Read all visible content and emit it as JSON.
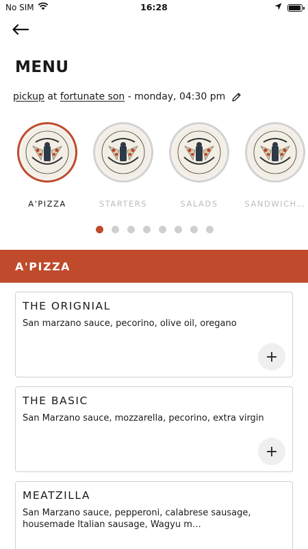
{
  "status_bar": {
    "carrier": "No SIM",
    "time": "16:28",
    "battery_level": 0.95
  },
  "header": {
    "back_icon": "arrow-left-icon",
    "title": "MENU"
  },
  "order_info": {
    "mode": "pickup",
    "at": "at",
    "location": "fortunate son",
    "separator": "-",
    "datetime": "monday, 04:30 pm",
    "edit_icon": "pencil-icon"
  },
  "categories": [
    {
      "label": "A'PIZZA",
      "active": true
    },
    {
      "label": "STARTERS",
      "active": false
    },
    {
      "label": "SALADS",
      "active": false
    },
    {
      "label": "SANDWICH…",
      "active": false
    }
  ],
  "pagination": {
    "total": 8,
    "active_index": 0
  },
  "section": {
    "title": "A'PIZZA"
  },
  "items": [
    {
      "name": "THE ORIGNIAL",
      "description": "San marzano sauce, pecorino, olive oil, oregano",
      "add_label": "+"
    },
    {
      "name": "THE BASIC",
      "description": "San Marzano sauce, mozzarella, pecorino, extra virgin",
      "add_label": "+"
    },
    {
      "name": "MEATZILLA",
      "description": "San Marzano sauce, pepperoni, calabrese sausage, housemade Italian sausage, Wagyu m…",
      "add_label": "+"
    }
  ],
  "colors": {
    "accent": "#bf4a2c",
    "inactive_label": "#bdbdbd",
    "card_border": "#cfcfcf"
  }
}
